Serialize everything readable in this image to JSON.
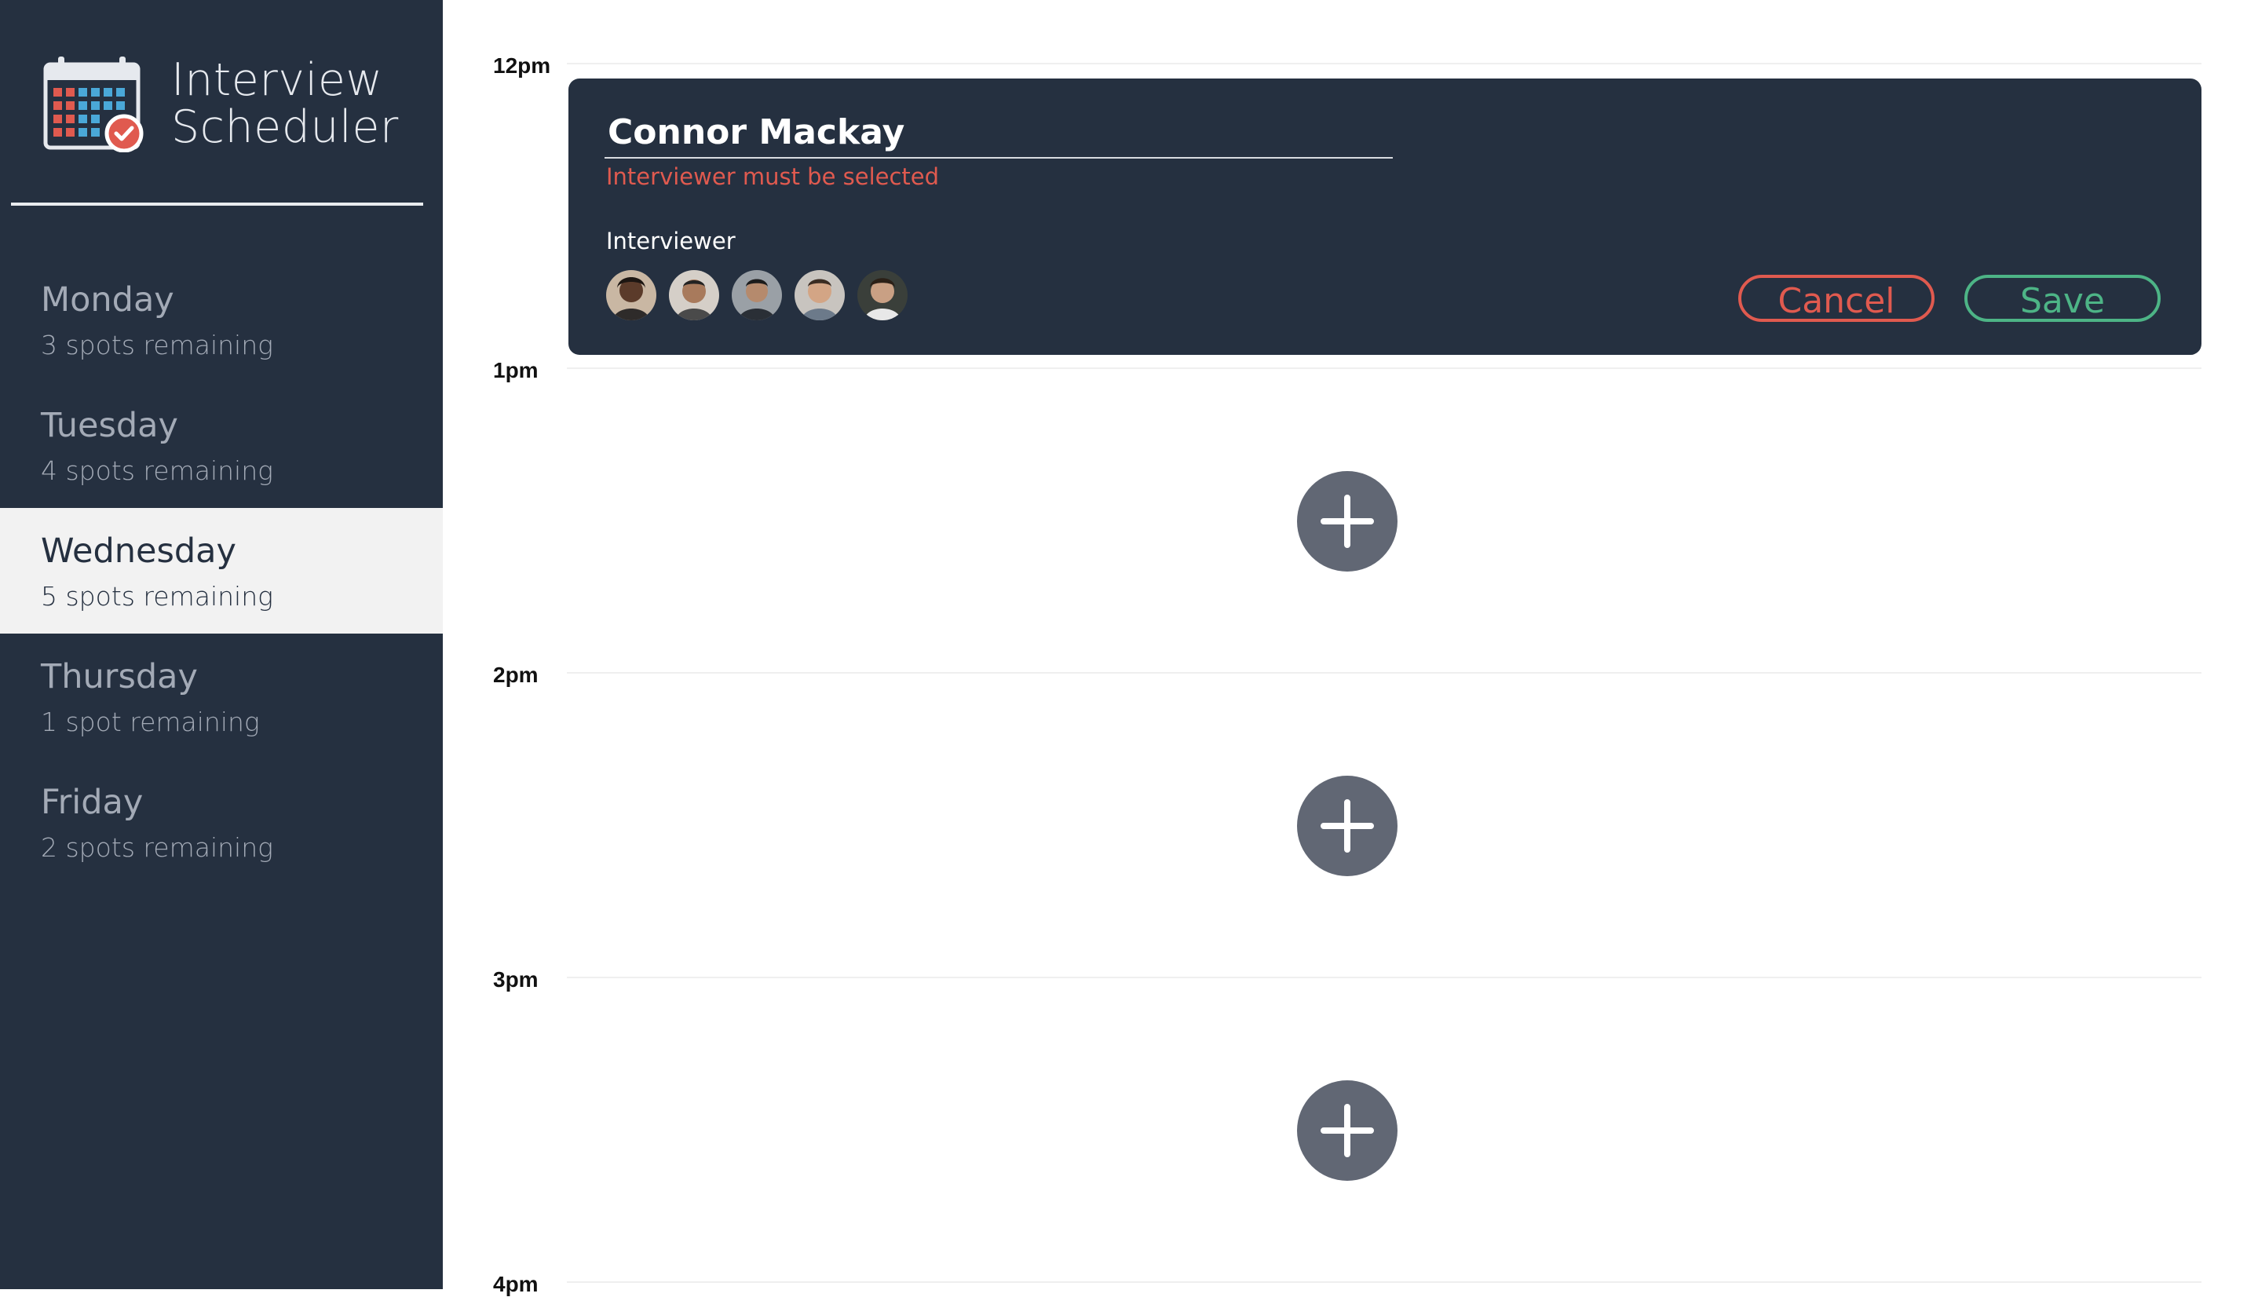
{
  "brand": {
    "line1": "Interview",
    "line2": "Scheduler",
    "icon": "calendar-icon"
  },
  "days": [
    {
      "name": "Monday",
      "spots": "3 spots remaining",
      "selected": false
    },
    {
      "name": "Tuesday",
      "spots": "4 spots remaining",
      "selected": false
    },
    {
      "name": "Wednesday",
      "spots": "5 spots remaining",
      "selected": true
    },
    {
      "name": "Thursday",
      "spots": "1 spot remaining",
      "selected": false
    },
    {
      "name": "Friday",
      "spots": "2 spots remaining",
      "selected": false
    }
  ],
  "schedule": {
    "slots": [
      "12pm",
      "1pm",
      "2pm",
      "3pm",
      "4pm"
    ]
  },
  "form": {
    "student_name": "Connor Mackay",
    "error": "Interviewer must be selected",
    "interviewer_label": "Interviewer",
    "interviewers": [
      {
        "icon": "avatar-icon"
      },
      {
        "icon": "avatar-icon"
      },
      {
        "icon": "avatar-icon"
      },
      {
        "icon": "avatar-icon"
      },
      {
        "icon": "avatar-icon"
      }
    ],
    "cancel": "Cancel",
    "save": "Save"
  },
  "colors": {
    "sidebar": "#253040",
    "selected_day": "#f2f2f2",
    "error": "#e05a4f",
    "save": "#4db486",
    "add_button": "#616774"
  }
}
